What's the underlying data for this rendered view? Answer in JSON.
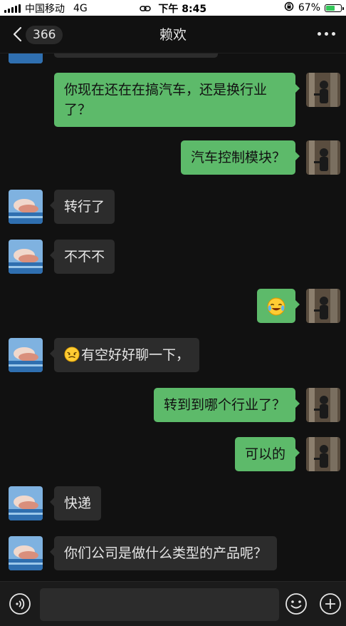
{
  "status_bar": {
    "carrier": "中国移动",
    "network": "4G",
    "time": "下午 8:45",
    "battery_percent": "67%",
    "battery_level": 0.67
  },
  "nav": {
    "unread_count": "366",
    "title": "赖欢",
    "back_icon": "chevron-left-icon",
    "more_icon": "more-dots-icon"
  },
  "messages": [
    {
      "side": "out",
      "text": "你现在还在在搞汽车，还是换行业了？"
    },
    {
      "side": "out",
      "text": "汽车控制模块？"
    },
    {
      "side": "in",
      "text": "转行了"
    },
    {
      "side": "in",
      "text": "不不不"
    },
    {
      "side": "out",
      "emoji": "crying-laughing-emoji",
      "text": ""
    },
    {
      "side": "in",
      "emoji": "grimace-emoji",
      "text": "有空好好聊一下，"
    },
    {
      "side": "out",
      "text": "转到到哪个行业了？"
    },
    {
      "side": "out",
      "text": "可以的"
    },
    {
      "side": "in",
      "text": "快递"
    },
    {
      "side": "in",
      "text": "你们公司是做什么类型的产品呢？"
    }
  ],
  "input_bar": {
    "voice_icon": "voice-icon",
    "emoji_icon": "emoji-icon",
    "add_icon": "add-icon",
    "placeholder": ""
  },
  "colors": {
    "background": "#111111",
    "incoming_bubble": "#2c2c2c",
    "outgoing_bubble": "#5dba6a"
  }
}
